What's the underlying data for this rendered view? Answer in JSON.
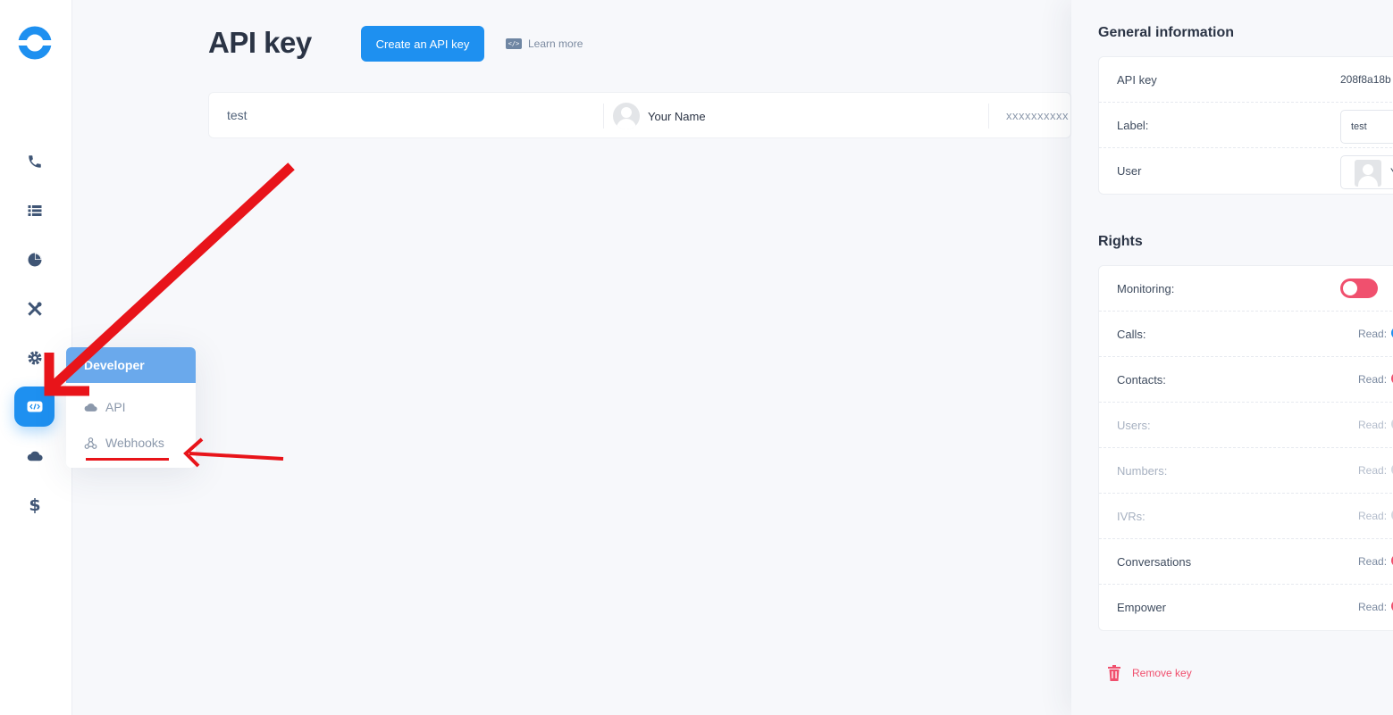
{
  "header": {
    "title": "API key",
    "create_button": "Create an API key",
    "learn_more": "Learn more"
  },
  "sidebar": {
    "items": [
      {
        "icon": "phone-icon"
      },
      {
        "icon": "list-icon"
      },
      {
        "icon": "pie-chart-icon"
      },
      {
        "icon": "tools-icon"
      },
      {
        "icon": "gear-icon"
      },
      {
        "icon": "code-icon",
        "active": true
      },
      {
        "icon": "cloud-icon"
      },
      {
        "icon": "dollar-icon"
      }
    ]
  },
  "submenu": {
    "title": "Developer",
    "items": [
      {
        "label": "API",
        "icon": "cloud-icon"
      },
      {
        "label": "Webhooks",
        "icon": "webhook-icon"
      }
    ]
  },
  "keys_table": {
    "rows": [
      {
        "label": "test",
        "user": "Your Name",
        "key": "xxxxxxxxxx"
      }
    ]
  },
  "panel": {
    "general_title": "General information",
    "general": {
      "api_key_label": "API key",
      "api_key_value": "208f8a18b",
      "label_label": "Label:",
      "label_value": "test",
      "user_label": "User",
      "user_initial": "Y"
    },
    "rights_title": "Rights",
    "rights": [
      {
        "label": "Monitoring:",
        "type": "toggle",
        "enabled": true
      },
      {
        "label": "Calls:",
        "read": "Read:",
        "dot_color": "#1e90f0",
        "dim": false
      },
      {
        "label": "Contacts:",
        "read": "Read:",
        "dot_color": "#f0506e",
        "dim": false
      },
      {
        "label": "Users:",
        "read": "Read:",
        "dot_color": "#d3d8e0",
        "dim": true
      },
      {
        "label": "Numbers:",
        "read": "Read:",
        "dot_color": "#d3d8e0",
        "dim": true
      },
      {
        "label": "IVRs:",
        "read": "Read:",
        "dot_color": "#d3d8e0",
        "dim": true
      },
      {
        "label": "Conversations",
        "read": "Read:",
        "dot_color": "#f0506e",
        "dim": false
      },
      {
        "label": "Empower",
        "read": "Read:",
        "dot_color": "#f0506e",
        "dim": false
      }
    ],
    "remove_key": "Remove key"
  },
  "colors": {
    "accent": "#1e90f0",
    "danger": "#f0506e",
    "annotation": "#e8141a"
  }
}
